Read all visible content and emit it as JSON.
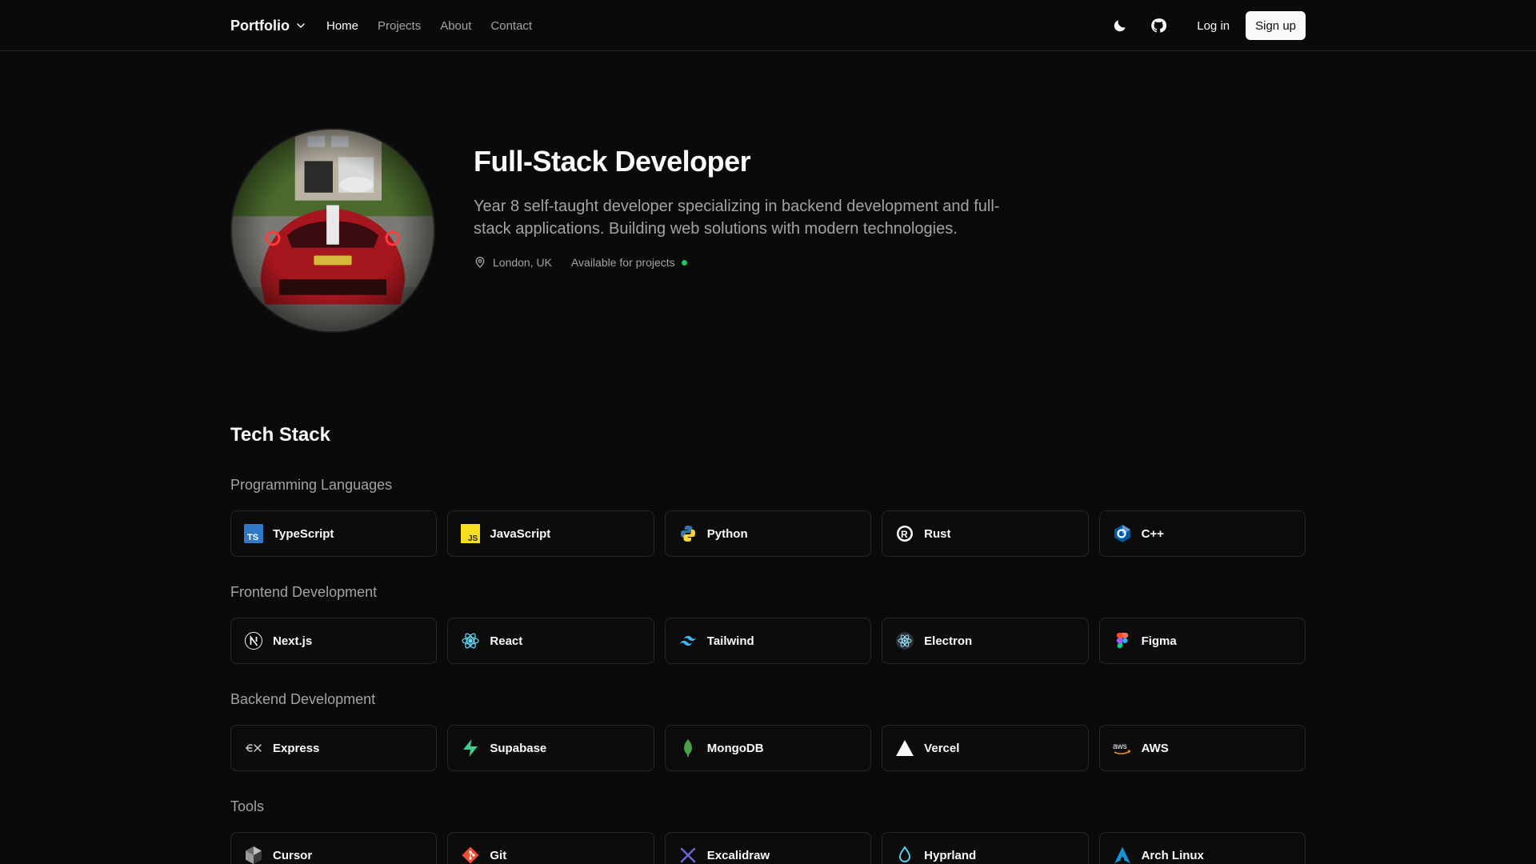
{
  "nav": {
    "brand": "Portfolio",
    "links": [
      {
        "label": "Home",
        "active": true
      },
      {
        "label": "Projects",
        "active": false
      },
      {
        "label": "About",
        "active": false
      },
      {
        "label": "Contact",
        "active": false
      }
    ],
    "login": "Log in",
    "signup": "Sign up"
  },
  "hero": {
    "title": "Full-Stack Developer",
    "description": "Year 8 self-taught developer specializing in backend development and full-stack applications. Building web solutions with modern technologies.",
    "location": "London, UK",
    "availability": "Available for projects",
    "availability_color": "#22c55e"
  },
  "stack": {
    "title": "Tech Stack",
    "categories": [
      {
        "title": "Programming Languages",
        "items": [
          {
            "label": "TypeScript",
            "icon": "typescript-icon"
          },
          {
            "label": "JavaScript",
            "icon": "javascript-icon"
          },
          {
            "label": "Python",
            "icon": "python-icon"
          },
          {
            "label": "Rust",
            "icon": "rust-icon"
          },
          {
            "label": "C++",
            "icon": "cpp-icon"
          }
        ]
      },
      {
        "title": "Frontend Development",
        "items": [
          {
            "label": "Next.js",
            "icon": "nextjs-icon"
          },
          {
            "label": "React",
            "icon": "react-icon"
          },
          {
            "label": "Tailwind",
            "icon": "tailwind-icon"
          },
          {
            "label": "Electron",
            "icon": "electron-icon"
          },
          {
            "label": "Figma",
            "icon": "figma-icon"
          }
        ]
      },
      {
        "title": "Backend Development",
        "items": [
          {
            "label": "Express",
            "icon": "express-icon"
          },
          {
            "label": "Supabase",
            "icon": "supabase-icon"
          },
          {
            "label": "MongoDB",
            "icon": "mongodb-icon"
          },
          {
            "label": "Vercel",
            "icon": "vercel-icon"
          },
          {
            "label": "AWS",
            "icon": "aws-icon"
          }
        ]
      },
      {
        "title": "Tools",
        "items": [
          {
            "label": "Cursor",
            "icon": "cursor-icon"
          },
          {
            "label": "Git",
            "icon": "git-icon"
          },
          {
            "label": "Excalidraw",
            "icon": "excalidraw-icon"
          },
          {
            "label": "Hyprland",
            "icon": "hyprland-icon"
          },
          {
            "label": "Arch Linux",
            "icon": "arch-linux-icon"
          }
        ]
      }
    ]
  }
}
